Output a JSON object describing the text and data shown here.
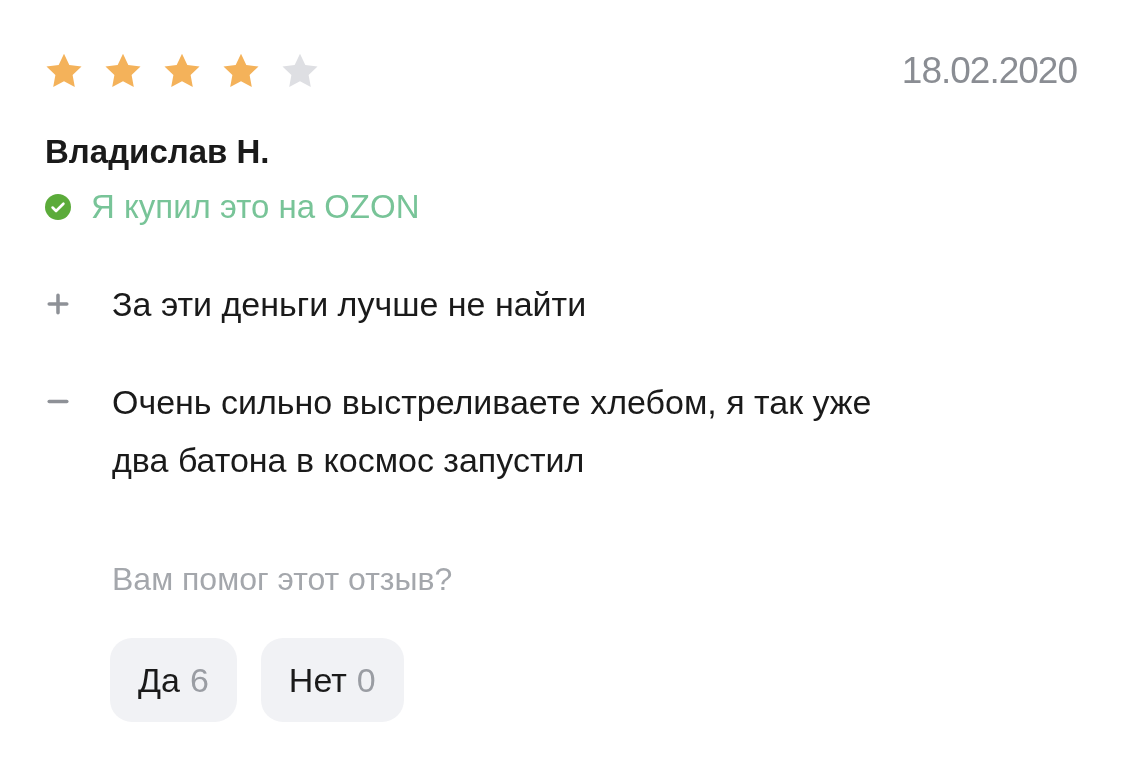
{
  "review": {
    "stars": 4,
    "date": "18.02.2020",
    "author": "Владислав Н.",
    "verified": {
      "label": "Я купил это на OZON"
    },
    "points": [
      {
        "kind": "plus",
        "text": "За эти деньги лучше не найти"
      },
      {
        "kind": "minus",
        "text": "Очень сильно выстреливаете хлебом, я так уже два батона в космос запустил"
      }
    ],
    "helpful": {
      "question": "Вам помог этот отзыв?",
      "buttons": [
        {
          "label": "Да",
          "count": "6"
        },
        {
          "label": "Нет",
          "count": "0"
        }
      ]
    }
  }
}
